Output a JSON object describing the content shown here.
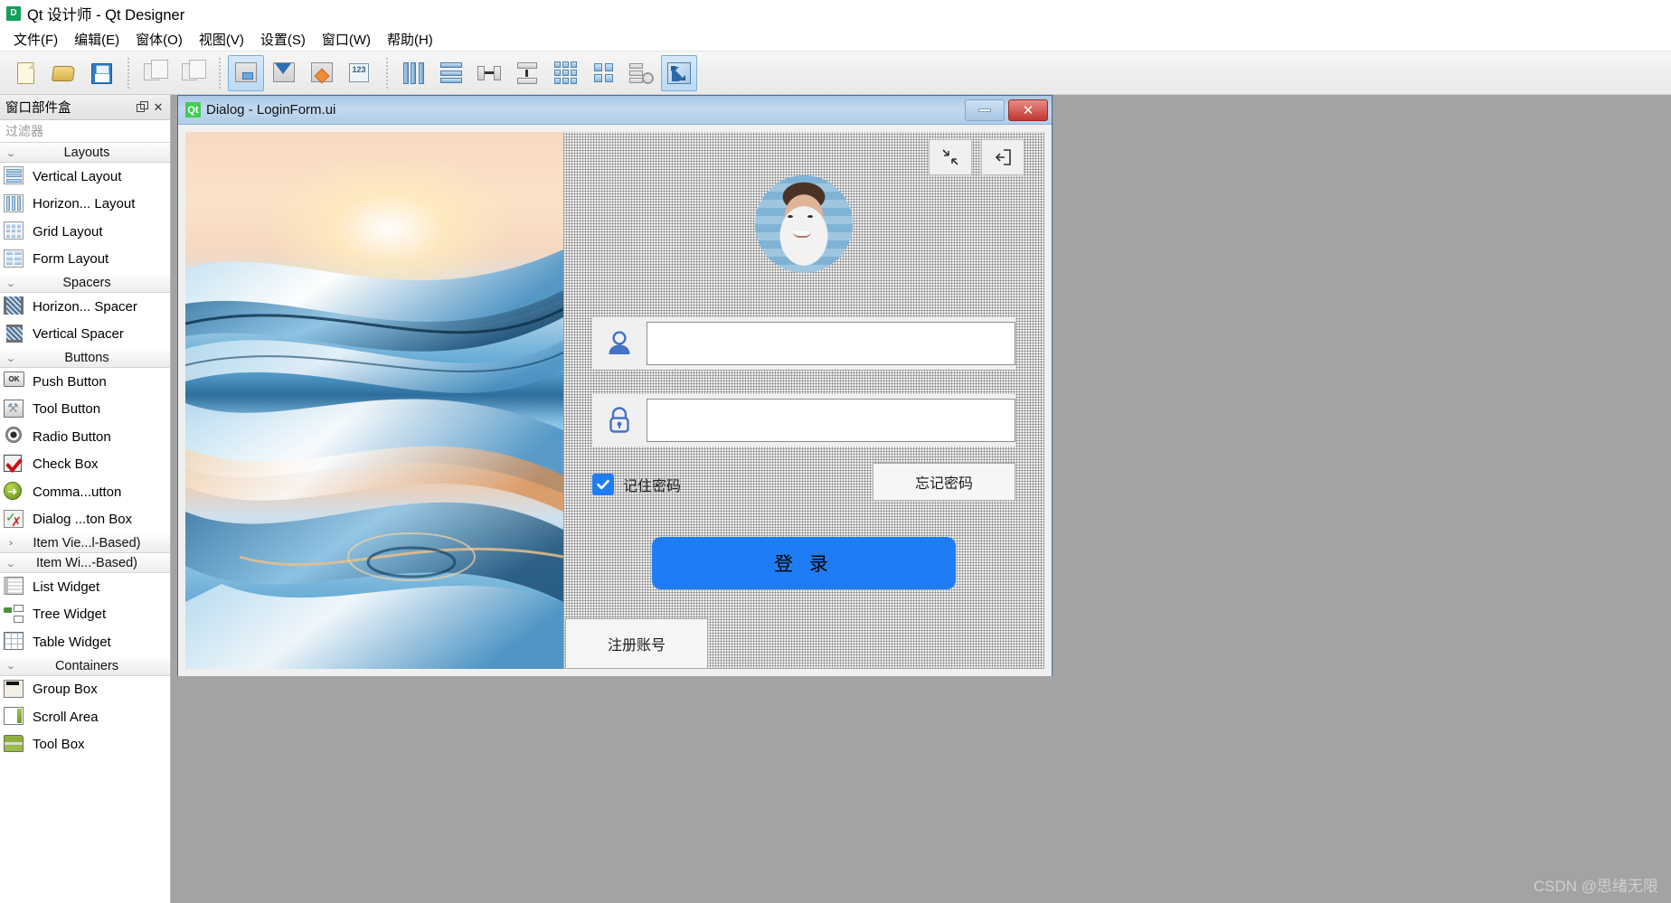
{
  "window": {
    "app_icon_text": "D",
    "title": "Qt 设计师 - Qt Designer"
  },
  "menubar": {
    "items": [
      {
        "label": "文件(F)",
        "name": "menu-file"
      },
      {
        "label": "编辑(E)",
        "name": "menu-edit"
      },
      {
        "label": "窗体(O)",
        "name": "menu-form"
      },
      {
        "label": "视图(V)",
        "name": "menu-view"
      },
      {
        "label": "设置(S)",
        "name": "menu-settings"
      },
      {
        "label": "窗口(W)",
        "name": "menu-window"
      },
      {
        "label": "帮助(H)",
        "name": "menu-help"
      }
    ]
  },
  "toolbar": {
    "icons": [
      "new-file-icon",
      "open-folder-icon",
      "save-icon",
      "separator",
      "cut-stack-icon",
      "copy-stack-icon",
      "separator",
      "edit-widgets-icon",
      "edit-signals-icon",
      "edit-buddies-icon",
      "edit-tab-order-icon",
      "separator",
      "layout-horizontally-icon",
      "layout-vertically-icon",
      "layout-in-splitter-horizontal-icon",
      "layout-in-splitter-vertical-icon",
      "layout-in-grid-icon",
      "layout-in-form-icon",
      "break-layout-icon",
      "adjust-size-icon"
    ]
  },
  "dock": {
    "title": "窗口部件盒",
    "float_icon": "float-icon",
    "close_icon": "close-icon",
    "filter_placeholder": "过滤器",
    "groups": [
      {
        "label": "Layouts",
        "expanded": true,
        "chevron": "⌄",
        "items": [
          {
            "label": "Vertical Layout",
            "icon": "vertical-layout-icon"
          },
          {
            "label": "Horizon... Layout",
            "icon": "horizontal-layout-icon"
          },
          {
            "label": "Grid Layout",
            "icon": "grid-layout-icon"
          },
          {
            "label": "Form Layout",
            "icon": "form-layout-icon"
          }
        ]
      },
      {
        "label": "Spacers",
        "expanded": true,
        "chevron": "⌄",
        "items": [
          {
            "label": "Horizon... Spacer",
            "icon": "horizontal-spacer-icon"
          },
          {
            "label": "Vertical Spacer",
            "icon": "vertical-spacer-icon"
          }
        ]
      },
      {
        "label": "Buttons",
        "expanded": true,
        "chevron": "⌄",
        "items": [
          {
            "label": "Push Button",
            "icon": "push-button-icon"
          },
          {
            "label": "Tool Button",
            "icon": "tool-button-icon"
          },
          {
            "label": "Radio Button",
            "icon": "radio-button-icon"
          },
          {
            "label": "Check Box",
            "icon": "check-box-icon"
          },
          {
            "label": "Comma...utton",
            "icon": "command-link-button-icon"
          },
          {
            "label": "Dialog ...ton Box",
            "icon": "dialog-button-box-icon"
          }
        ]
      },
      {
        "label": "Item Vie...l-Based)",
        "expanded": false,
        "chevron": "›",
        "items": []
      },
      {
        "label": "Item Wi...-Based)",
        "expanded": true,
        "chevron": "⌄",
        "items": [
          {
            "label": "List Widget",
            "icon": "list-widget-icon"
          },
          {
            "label": "Tree Widget",
            "icon": "tree-widget-icon"
          },
          {
            "label": "Table Widget",
            "icon": "table-widget-icon"
          }
        ]
      },
      {
        "label": "Containers",
        "expanded": true,
        "chevron": "⌄",
        "items": [
          {
            "label": "Group Box",
            "icon": "group-box-icon"
          },
          {
            "label": "Scroll Area",
            "icon": "scroll-area-icon"
          },
          {
            "label": "Tool Box",
            "icon": "tool-box-icon"
          }
        ]
      }
    ]
  },
  "form": {
    "icon_text": "Qt",
    "title": "Dialog - LoginForm.ui",
    "minimize_label": "",
    "close_label": "✕",
    "left_image_alt": "abstract-blue-wave-background",
    "top_tools": [
      {
        "name": "collapse-icon",
        "glyph": "minimize-arrows"
      },
      {
        "name": "exit-icon",
        "glyph": "logout"
      }
    ],
    "avatar_alt": "user-avatar-photo",
    "username_field": {
      "value": "",
      "placeholder": ""
    },
    "password_field": {
      "value": "",
      "placeholder": ""
    },
    "remember_label": "记住密码",
    "remember_checked": true,
    "forgot_label": "忘记密码",
    "login_label": "登 录",
    "register_label": "注册账号",
    "colors": {
      "accent": "#1e7df5",
      "field_icon": "#4472c4",
      "title_bar": "#b2cde9",
      "close_button": "#c0382f"
    }
  },
  "watermark": "CSDN @思绪无限"
}
